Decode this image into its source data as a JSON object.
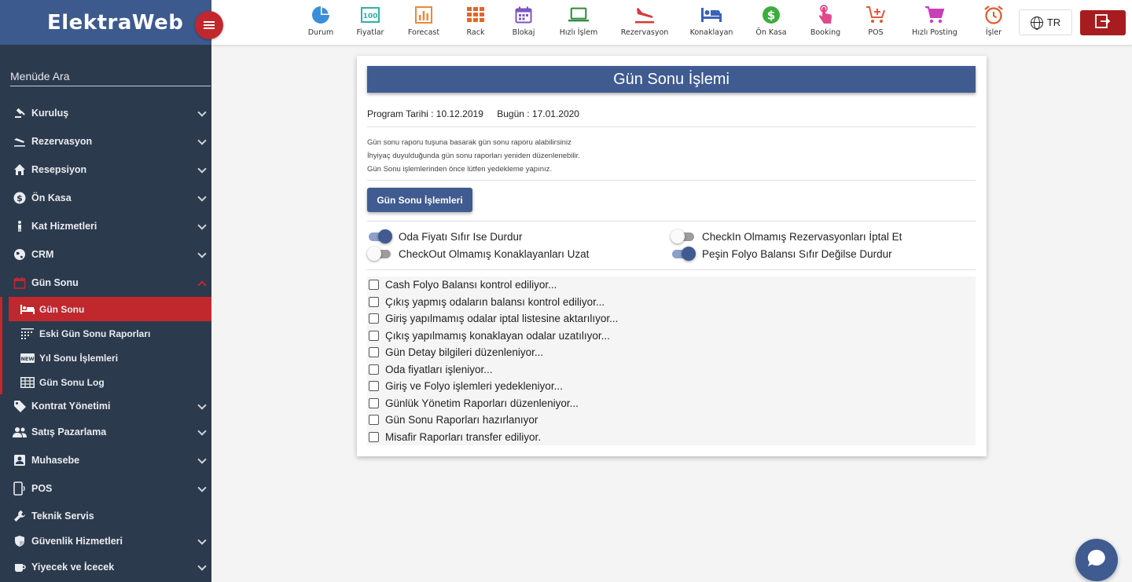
{
  "app": {
    "brand": "ElektraWeb",
    "language": "TR"
  },
  "sidebar": {
    "search_label": "Menüde Ara",
    "items": [
      {
        "label": "Kuruluş",
        "icon": "gavel-icon"
      },
      {
        "label": "Rezervasyon",
        "icon": "plane-landing-icon"
      },
      {
        "label": "Resepsiyon",
        "icon": "home-icon"
      },
      {
        "label": "Ön Kasa",
        "icon": "dollar-icon"
      },
      {
        "label": "Kat Hizmetleri",
        "icon": "person-icon"
      },
      {
        "label": "CRM",
        "icon": "globe-icon"
      },
      {
        "label": "Gün Sonu",
        "icon": "calendar-icon"
      }
    ],
    "sub_items": [
      {
        "label": "Gün Sonu",
        "icon": "bed-icon"
      },
      {
        "label": "Eski Gün Sonu Raporları",
        "icon": "dots-grid-icon"
      },
      {
        "label": "Yıl Sonu İşlemleri",
        "icon": "new-badge-icon"
      },
      {
        "label": "Gün Sonu Log",
        "icon": "table-icon"
      }
    ],
    "items_after": [
      {
        "label": "Kontrat Yönetimi",
        "icon": "tag-icon"
      },
      {
        "label": "Satış Pazarlama",
        "icon": "people-icon"
      },
      {
        "label": "Muhasebe",
        "icon": "contact-icon"
      },
      {
        "label": "POS",
        "icon": "mobile-icon"
      },
      {
        "label": "Teknik Servis",
        "icon": "wrench-icon"
      },
      {
        "label": "Güvenlik Hizmetleri",
        "icon": "shield-icon"
      },
      {
        "label": "Yiyecek ve İcecek",
        "icon": "cup-icon"
      }
    ]
  },
  "topbar": {
    "items": [
      {
        "label": "Durum",
        "icon": "pie-chart-icon",
        "color": "#3b8fd9"
      },
      {
        "label": "Fiyatlar",
        "icon": "price-icon",
        "color": "#2bb3a6"
      },
      {
        "label": "Forecast",
        "icon": "bar-chart-icon",
        "color": "#e8893a"
      },
      {
        "label": "Rack",
        "icon": "grid-icon",
        "color": "#e0662a"
      },
      {
        "label": "Blokaj",
        "icon": "calendar-icon",
        "color": "#7a55c2"
      },
      {
        "label": "Hızlı İşlem",
        "icon": "laptop-icon",
        "color": "#2e8b3a"
      },
      {
        "label": "Rezervasyon",
        "icon": "plane-landing-icon",
        "color": "#d63a3a"
      },
      {
        "label": "Konaklayan",
        "icon": "bed-icon",
        "color": "#3b62b8"
      },
      {
        "label": "Ön Kasa",
        "icon": "dollar-circle-icon",
        "color": "#3cae3c"
      },
      {
        "label": "Booking",
        "icon": "touch-icon",
        "color": "#e0498c"
      },
      {
        "label": "POS",
        "icon": "cart-plus-icon",
        "color": "#e05a3a"
      },
      {
        "label": "Hızlı Posting",
        "icon": "cart-icon",
        "color": "#c740b8"
      },
      {
        "label": "İşler",
        "icon": "alarm-icon",
        "color": "#e05a2a"
      }
    ]
  },
  "main": {
    "title": "Gün Sonu İşlemi",
    "program_date": "Program Tarihi : 10.12.2019",
    "today": "Bugün : 17.01.2020",
    "info_lines": [
      "Gün sonu raporu tuşuna basarak gün sonu raporu alabilirsiniz",
      "İhyiyaç duyulduğunda gün sonu raporları yeniden düzenlenebilir.",
      "Gün Sonu işlemlerinden önce lütfen yedekleme yapınız."
    ],
    "action_button": "Gün Sonu İşlemleri",
    "toggles": [
      {
        "label": "Oda Fiyatı Sıfır Ise Durdur",
        "on": true
      },
      {
        "label": "CheckIn Olmamış Rezervasyonları İptal Et",
        "on": false
      },
      {
        "label": "CheckOut Olmamış Konaklayanları Uzat",
        "on": false
      },
      {
        "label": "Peşin Folyo Balansı Sıfır Değilse Durdur",
        "on": true
      }
    ],
    "checklist": [
      "Cash Folyo Balansı kontrol ediliyor...",
      "Çıkış yapmış odaların balansı kontrol ediliyor...",
      "Giriş yapılmamış odalar iptal listesine aktarılıyor...",
      "Çıkış yapılmamış konaklayan odalar uzatılıyor...",
      "Gün Detay bilgileri düzenleniyor...",
      "Oda fiyatları işleniyor...",
      "Giriş ve Folyo işlemleri yedekleniyor...",
      "Günlük Yönetim Raporları düzenleniyor...",
      "Gün Sonu Raporları hazırlanıyor",
      "Misafir Raporları transfer ediliyor."
    ]
  }
}
